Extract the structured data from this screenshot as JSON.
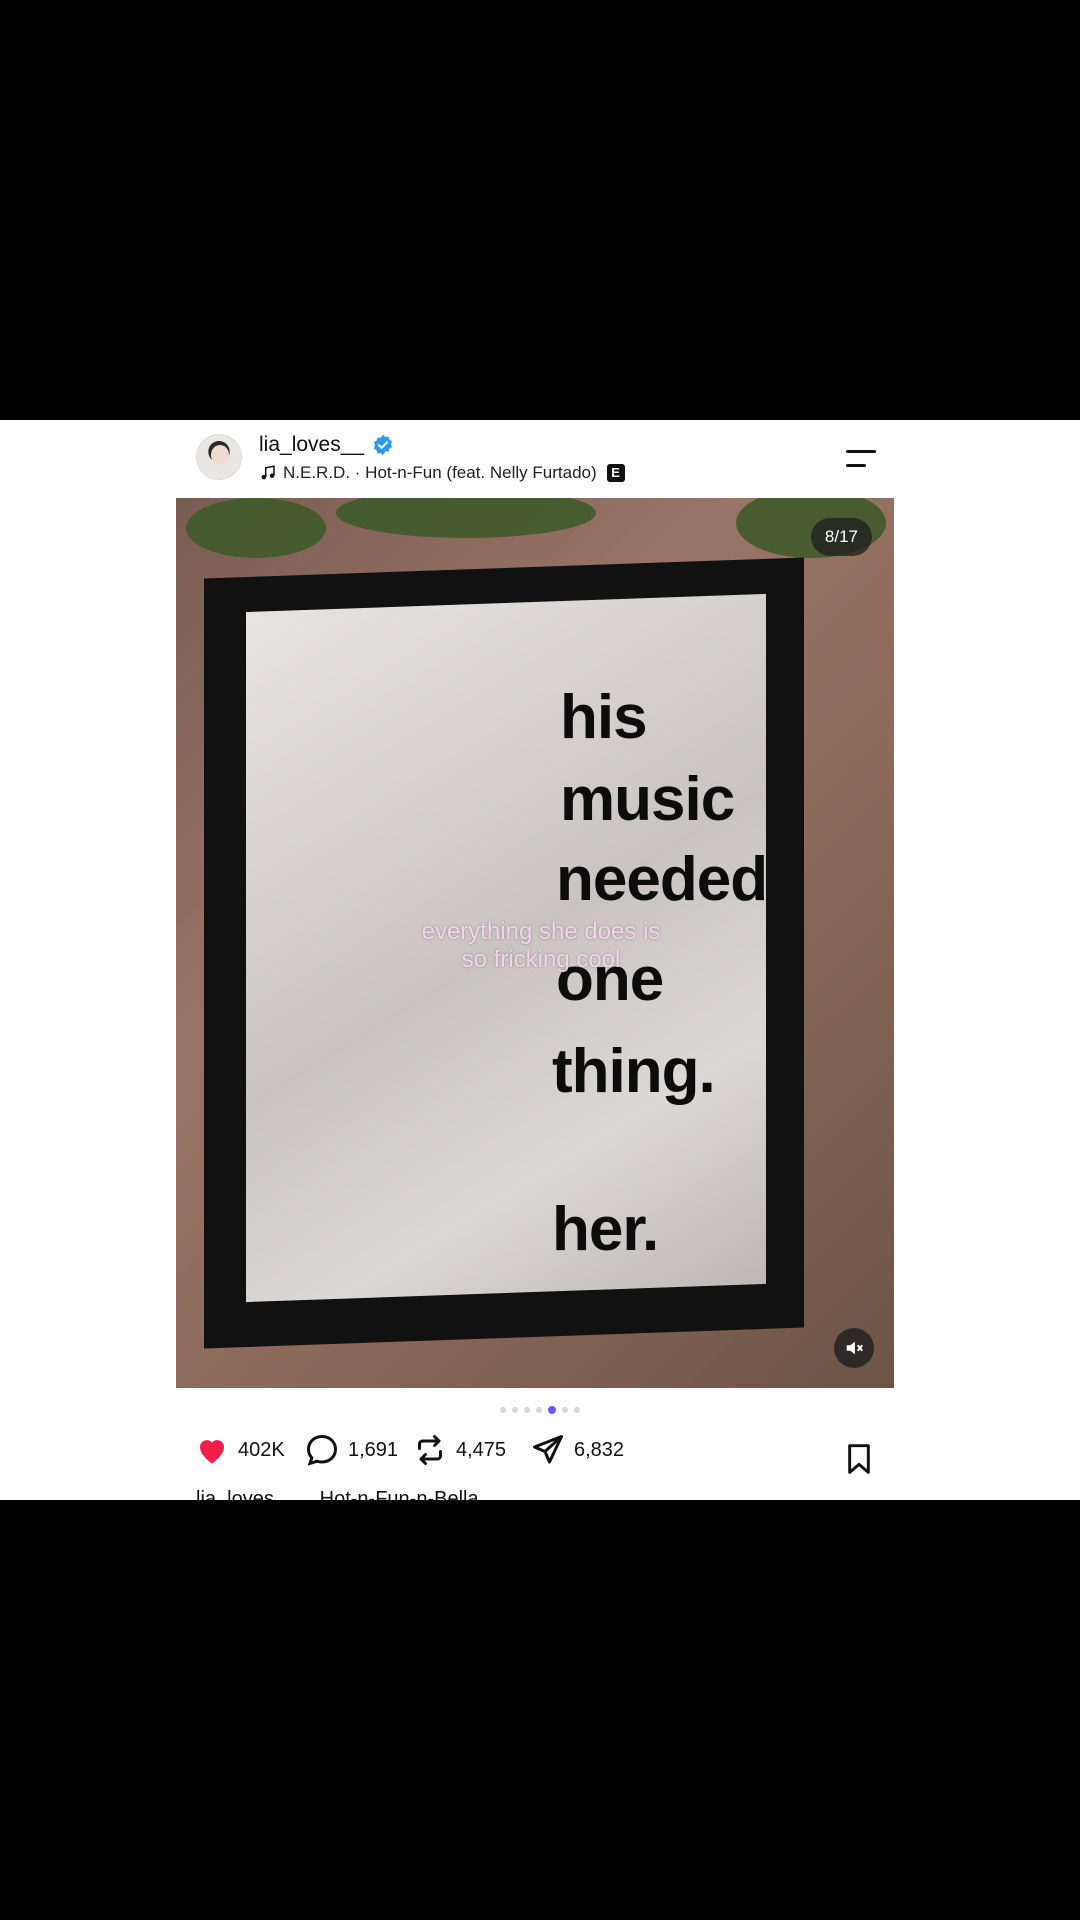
{
  "post": {
    "username": "lia_loves__",
    "music": "N.E.R.D. · Hot-n-Fun (feat. Nelly Furtado)",
    "explicit_badge": "E",
    "counter": "8/17",
    "mirror_words": [
      "his",
      "music",
      "needed",
      "one",
      "thing.",
      "her."
    ],
    "overlay_caption": "everything she does is so fricking cool",
    "carousel": {
      "total_visible_dots": 7,
      "active_index": 4
    }
  },
  "actions": {
    "likes": "402K",
    "comments": "1,691",
    "reposts": "4,475",
    "shares": "6,832"
  },
  "caption": {
    "user": "lia_loves__",
    "text": "Hot-n-Fun-n-Bella"
  },
  "colors": {
    "like": "#f0204a",
    "active_dot": "#6a58ff",
    "verified": "#2f9bf0"
  }
}
